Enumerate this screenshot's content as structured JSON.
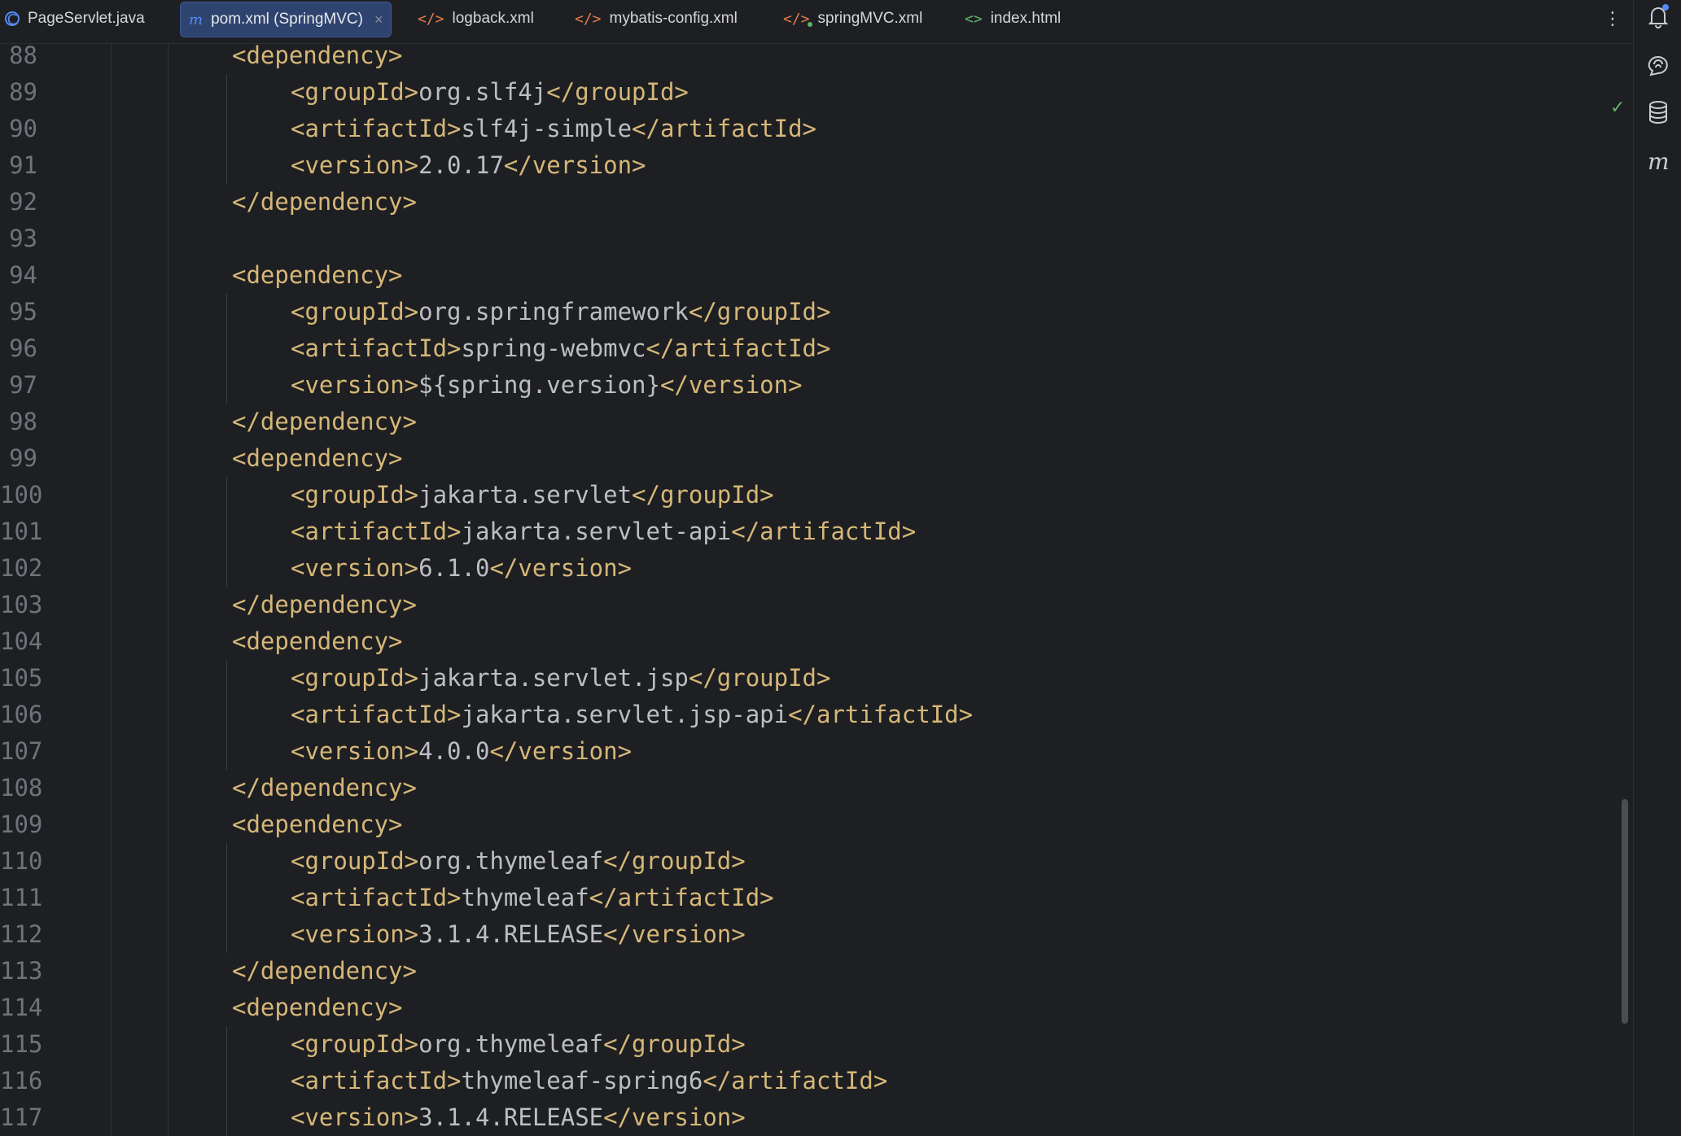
{
  "tabs": [
    {
      "label": "PageServlet.java",
      "icon": "java-class-icon"
    },
    {
      "label": "pom.xml (SpringMVC)",
      "icon": "maven-icon",
      "active": true
    },
    {
      "label": "logback.xml",
      "icon": "xml-icon"
    },
    {
      "label": "mybatis-config.xml",
      "icon": "xml-icon"
    },
    {
      "label": "springMVC.xml",
      "icon": "spring-xml-icon"
    },
    {
      "label": "index.html",
      "icon": "html-icon"
    }
  ],
  "tab_close_glyph": "×",
  "more_glyph": "⋮",
  "right_toolbar": [
    "notifications-icon",
    "ai-assistant-icon",
    "database-icon",
    "maven-icon"
  ],
  "inspection_status": "✓",
  "lines": [
    {
      "n": "88",
      "indent": 1,
      "tag1": "<dependency>",
      "text": "",
      "tag2": ""
    },
    {
      "n": "89",
      "indent": 2,
      "tag1": "<groupId>",
      "text": "org.slf4j",
      "tag2": "</groupId>"
    },
    {
      "n": "90",
      "indent": 2,
      "tag1": "<artifactId>",
      "text": "slf4j-simple",
      "tag2": "</artifactId>"
    },
    {
      "n": "91",
      "indent": 2,
      "tag1": "<version>",
      "text": "2.0.17",
      "tag2": "</version>"
    },
    {
      "n": "92",
      "indent": 1,
      "tag1": "</dependency>",
      "text": "",
      "tag2": ""
    },
    {
      "n": "93",
      "indent": 1,
      "tag1": "",
      "text": "",
      "tag2": ""
    },
    {
      "n": "94",
      "indent": 1,
      "tag1": "<dependency>",
      "text": "",
      "tag2": ""
    },
    {
      "n": "95",
      "indent": 2,
      "tag1": "<groupId>",
      "text": "org.springframework",
      "tag2": "</groupId>"
    },
    {
      "n": "96",
      "indent": 2,
      "tag1": "<artifactId>",
      "text": "spring-webmvc",
      "tag2": "</artifactId>"
    },
    {
      "n": "97",
      "indent": 2,
      "tag1": "<version>",
      "text": "${spring.version}",
      "tag2": "</version>"
    },
    {
      "n": "98",
      "indent": 1,
      "tag1": "</dependency>",
      "text": "",
      "tag2": ""
    },
    {
      "n": "99",
      "indent": 1,
      "tag1": "<dependency>",
      "text": "",
      "tag2": ""
    },
    {
      "n": "100",
      "indent": 2,
      "tag1": "<groupId>",
      "text": "jakarta.servlet",
      "tag2": "</groupId>"
    },
    {
      "n": "101",
      "indent": 2,
      "tag1": "<artifactId>",
      "text": "jakarta.servlet-api",
      "tag2": "</artifactId>"
    },
    {
      "n": "102",
      "indent": 2,
      "tag1": "<version>",
      "text": "6.1.0",
      "tag2": "</version>"
    },
    {
      "n": "103",
      "indent": 1,
      "tag1": "</dependency>",
      "text": "",
      "tag2": ""
    },
    {
      "n": "104",
      "indent": 1,
      "tag1": "<dependency>",
      "text": "",
      "tag2": ""
    },
    {
      "n": "105",
      "indent": 2,
      "tag1": "<groupId>",
      "text": "jakarta.servlet.jsp",
      "tag2": "</groupId>"
    },
    {
      "n": "106",
      "indent": 2,
      "tag1": "<artifactId>",
      "text": "jakarta.servlet.jsp-api",
      "tag2": "</artifactId>"
    },
    {
      "n": "107",
      "indent": 2,
      "tag1": "<version>",
      "text": "4.0.0",
      "tag2": "</version>"
    },
    {
      "n": "108",
      "indent": 1,
      "tag1": "</dependency>",
      "text": "",
      "tag2": ""
    },
    {
      "n": "109",
      "indent": 1,
      "tag1": "<dependency>",
      "text": "",
      "tag2": ""
    },
    {
      "n": "110",
      "indent": 2,
      "tag1": "<groupId>",
      "text": "org.thymeleaf",
      "tag2": "</groupId>"
    },
    {
      "n": "111",
      "indent": 2,
      "tag1": "<artifactId>",
      "text": "thymeleaf",
      "tag2": "</artifactId>"
    },
    {
      "n": "112",
      "indent": 2,
      "tag1": "<version>",
      "text": "3.1.4.RELEASE",
      "tag2": "</version>"
    },
    {
      "n": "113",
      "indent": 1,
      "tag1": "</dependency>",
      "text": "",
      "tag2": ""
    },
    {
      "n": "114",
      "indent": 1,
      "tag1": "<dependency>",
      "text": "",
      "tag2": ""
    },
    {
      "n": "115",
      "indent": 2,
      "tag1": "<groupId>",
      "text": "org.thymeleaf",
      "tag2": "</groupId>"
    },
    {
      "n": "116",
      "indent": 2,
      "tag1": "<artifactId>",
      "text": "thymeleaf-spring6",
      "tag2": "</artifactId>"
    },
    {
      "n": "117",
      "indent": 2,
      "tag1": "<version>",
      "text": "3.1.4.RELEASE",
      "tag2": "</version>"
    }
  ]
}
